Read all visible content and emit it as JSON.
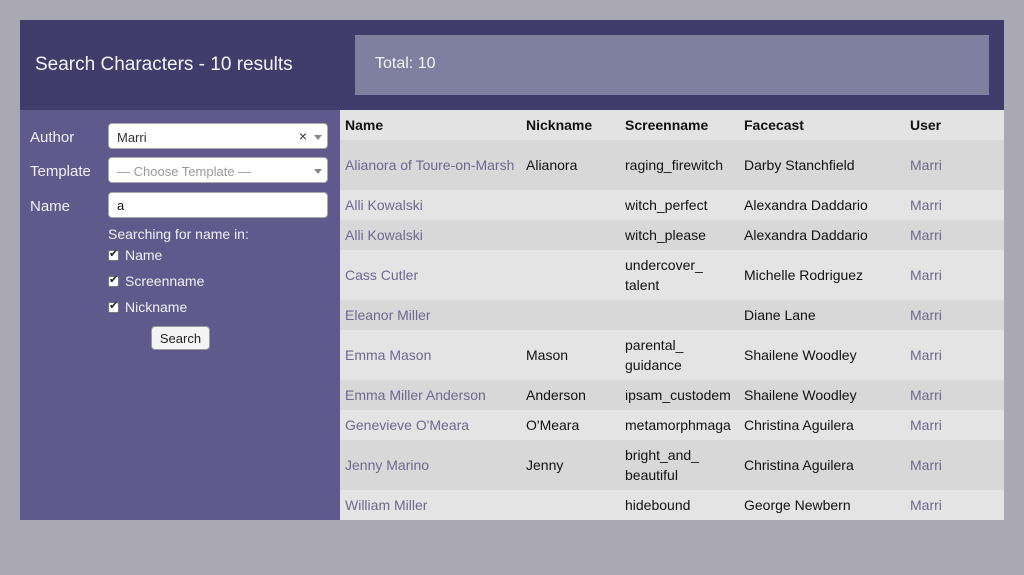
{
  "header": {
    "title": "Search Characters - 10 results",
    "total": "Total: 10"
  },
  "form": {
    "author_label": "Author",
    "author_value": "Marri",
    "template_label": "Template",
    "template_placeholder": "— Choose Template —",
    "name_label": "Name",
    "name_value": "a",
    "search_hint": "Searching for name in:",
    "checks": [
      {
        "label": "Name",
        "checked": true
      },
      {
        "label": "Screenname",
        "checked": true
      },
      {
        "label": "Nickname",
        "checked": true
      }
    ],
    "search_button": "Search",
    "clear_symbol": "×"
  },
  "table": {
    "columns": [
      "Name",
      "Nickname",
      "Screenname",
      "Facecast",
      "User"
    ],
    "rows": [
      {
        "name": "Alianora of Toure-on-Marsh",
        "nickname": "Alianora",
        "screenname": "raging_firewitch",
        "facecast": "Darby Stanchfield",
        "user": "Marri"
      },
      {
        "name": "Alli Kowalski",
        "nickname": "",
        "screenname": "witch_perfect",
        "facecast": "Alexandra Daddario",
        "user": "Marri"
      },
      {
        "name": "Alli Kowalski",
        "nickname": "",
        "screenname": "witch_please",
        "facecast": "Alexandra Daddario",
        "user": "Marri"
      },
      {
        "name": "Cass Cutler",
        "nickname": "",
        "screenname": "undercover_ talent",
        "facecast": "Michelle Rodriguez",
        "user": "Marri"
      },
      {
        "name": "Eleanor Miller",
        "nickname": "",
        "screenname": "",
        "facecast": "Diane Lane",
        "user": "Marri"
      },
      {
        "name": "Emma Mason",
        "nickname": "Mason",
        "screenname": "parental_ guidance",
        "facecast": "Shailene Woodley",
        "user": "Marri"
      },
      {
        "name": "Emma Miller Anderson",
        "nickname": "Anderson",
        "screenname": "ipsam_custodem",
        "facecast": "Shailene Woodley",
        "user": "Marri"
      },
      {
        "name": "Genevieve O'Meara",
        "nickname": "O'Meara",
        "screenname": "metamorphmaga",
        "facecast": "Christina Aguilera",
        "user": "Marri"
      },
      {
        "name": "Jenny Marino",
        "nickname": "Jenny",
        "screenname": "bright_and_ beautiful",
        "facecast": "Christina Aguilera",
        "user": "Marri"
      },
      {
        "name": "William Miller",
        "nickname": "",
        "screenname": "hidebound",
        "facecast": "George Newbern",
        "user": "Marri"
      }
    ]
  }
}
